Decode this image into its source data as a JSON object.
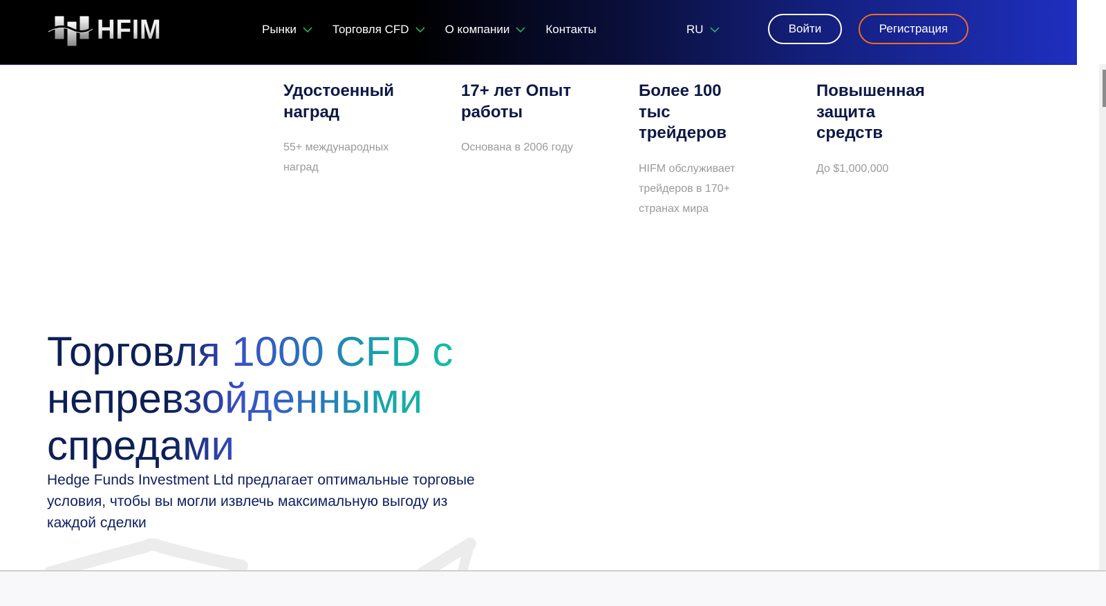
{
  "header": {
    "logo_text": "HFIM",
    "nav": [
      {
        "label": "Рынки",
        "has_dropdown": true
      },
      {
        "label": "Торговля CFD",
        "has_dropdown": true
      },
      {
        "label": "О компании",
        "has_dropdown": true
      },
      {
        "label": "Контакты",
        "has_dropdown": false
      }
    ],
    "language": "RU",
    "login_label": "Войти",
    "register_label": "Регистрация",
    "colors": {
      "chevron": "#1fb56b",
      "register_border": "#f26b1d",
      "login_border": "#ffffff"
    }
  },
  "features": [
    {
      "title": "Удостоенный наград",
      "description": "55+ международных наград"
    },
    {
      "title": "17+ лет Опыт работы",
      "description": "Основана в 2006 году"
    },
    {
      "title": "Более 100 тыс трейдеров",
      "description": "HIFM обслуживает трейдеров в 170+ странах мира"
    },
    {
      "title": "Повышенная защита средств",
      "description": "До $1,000,000"
    }
  ],
  "hero": {
    "title": "Торговля 1000 CFD с непревзойденными спредами",
    "description": "Hedge Funds Investment Ltd предлагает оптимальные торговые условия, чтобы вы могли извлечь максимальную выгоду из каждой сделки"
  }
}
